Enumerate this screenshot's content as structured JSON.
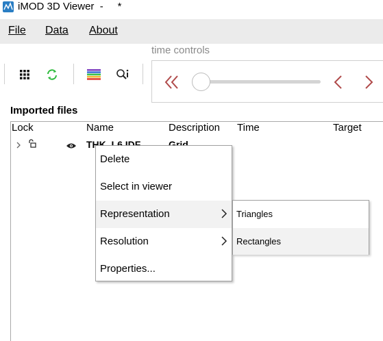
{
  "window": {
    "title": "iMOD 3D Viewer",
    "title_suffix": "  -     *"
  },
  "menu": {
    "file": "File",
    "data": "Data",
    "about": "About"
  },
  "toolbar": {
    "icons": [
      "grid-icon",
      "refresh-icon",
      "color-legend-icon",
      "search-settings-icon"
    ]
  },
  "time_controls": {
    "label": "time controls",
    "slider_position": 0
  },
  "imported_files": {
    "title": "Imported files",
    "columns": [
      "Lock",
      "Name",
      "Description",
      "Time",
      "Target"
    ],
    "row": {
      "name": "THK_L6.IDF",
      "description": "Grid"
    }
  },
  "context_menu": {
    "items": [
      "Delete",
      "Select in viewer",
      "Representation",
      "Resolution",
      "Properties..."
    ],
    "highlighted": "Representation"
  },
  "submenu": {
    "items": [
      "Triangles",
      "Rectangles"
    ],
    "highlighted": "Rectangles"
  },
  "colors": {
    "accent_red": "#b04a4a",
    "refresh_green": "#2dbb3c",
    "app_icon": "#2a7ec4"
  }
}
